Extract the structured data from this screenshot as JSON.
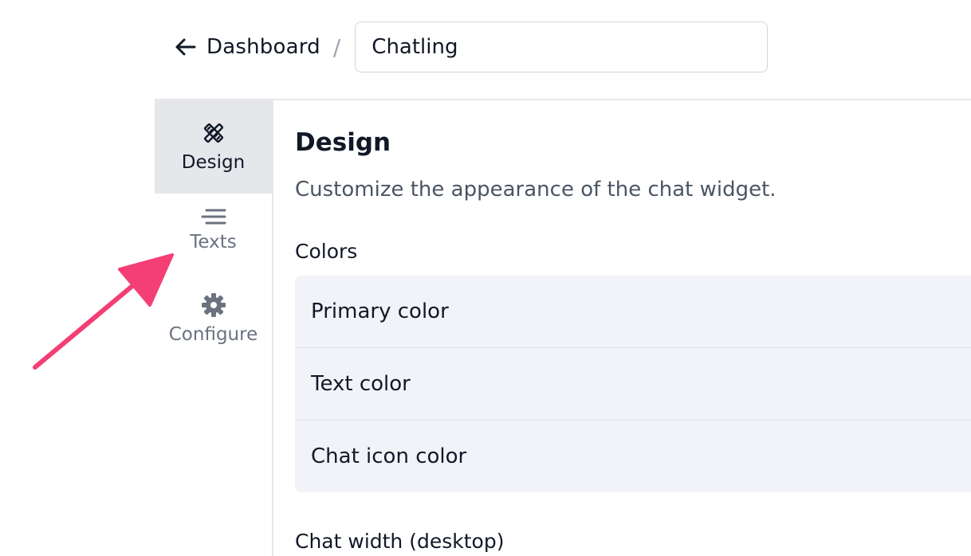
{
  "header": {
    "back_label": "Dashboard",
    "separator": "/",
    "name_value": "Chatling"
  },
  "sidebar": {
    "items": [
      {
        "label": "Design",
        "icon": "design-tools-icon",
        "active": true
      },
      {
        "label": "Texts",
        "icon": "text-lines-icon",
        "active": false
      },
      {
        "label": "Configure",
        "icon": "gear-icon",
        "active": false
      }
    ]
  },
  "main": {
    "title": "Design",
    "description": "Customize the appearance of the chat widget.",
    "colors_title": "Colors",
    "color_rows": [
      "Primary color",
      "Text color",
      "Chat icon color"
    ],
    "next_section_title": "Chat width (desktop)"
  },
  "annotation": {
    "arrow_color": "#f43f75"
  },
  "theme": {
    "active_tab_bg": "#e5e7eb",
    "panel_bg": "#f1f3f8",
    "border": "#e5e7eb"
  }
}
